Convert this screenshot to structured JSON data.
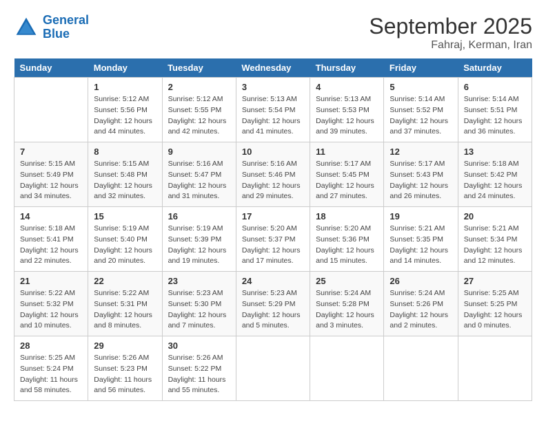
{
  "logo": {
    "line1": "General",
    "line2": "Blue"
  },
  "title": "September 2025",
  "location": "Fahraj, Kerman, Iran",
  "days_of_week": [
    "Sunday",
    "Monday",
    "Tuesday",
    "Wednesday",
    "Thursday",
    "Friday",
    "Saturday"
  ],
  "weeks": [
    [
      {
        "day": "",
        "sunrise": "",
        "sunset": "",
        "daylight": ""
      },
      {
        "day": "1",
        "sunrise": "Sunrise: 5:12 AM",
        "sunset": "Sunset: 5:56 PM",
        "daylight": "Daylight: 12 hours and 44 minutes."
      },
      {
        "day": "2",
        "sunrise": "Sunrise: 5:12 AM",
        "sunset": "Sunset: 5:55 PM",
        "daylight": "Daylight: 12 hours and 42 minutes."
      },
      {
        "day": "3",
        "sunrise": "Sunrise: 5:13 AM",
        "sunset": "Sunset: 5:54 PM",
        "daylight": "Daylight: 12 hours and 41 minutes."
      },
      {
        "day": "4",
        "sunrise": "Sunrise: 5:13 AM",
        "sunset": "Sunset: 5:53 PM",
        "daylight": "Daylight: 12 hours and 39 minutes."
      },
      {
        "day": "5",
        "sunrise": "Sunrise: 5:14 AM",
        "sunset": "Sunset: 5:52 PM",
        "daylight": "Daylight: 12 hours and 37 minutes."
      },
      {
        "day": "6",
        "sunrise": "Sunrise: 5:14 AM",
        "sunset": "Sunset: 5:51 PM",
        "daylight": "Daylight: 12 hours and 36 minutes."
      }
    ],
    [
      {
        "day": "7",
        "sunrise": "Sunrise: 5:15 AM",
        "sunset": "Sunset: 5:49 PM",
        "daylight": "Daylight: 12 hours and 34 minutes."
      },
      {
        "day": "8",
        "sunrise": "Sunrise: 5:15 AM",
        "sunset": "Sunset: 5:48 PM",
        "daylight": "Daylight: 12 hours and 32 minutes."
      },
      {
        "day": "9",
        "sunrise": "Sunrise: 5:16 AM",
        "sunset": "Sunset: 5:47 PM",
        "daylight": "Daylight: 12 hours and 31 minutes."
      },
      {
        "day": "10",
        "sunrise": "Sunrise: 5:16 AM",
        "sunset": "Sunset: 5:46 PM",
        "daylight": "Daylight: 12 hours and 29 minutes."
      },
      {
        "day": "11",
        "sunrise": "Sunrise: 5:17 AM",
        "sunset": "Sunset: 5:45 PM",
        "daylight": "Daylight: 12 hours and 27 minutes."
      },
      {
        "day": "12",
        "sunrise": "Sunrise: 5:17 AM",
        "sunset": "Sunset: 5:43 PM",
        "daylight": "Daylight: 12 hours and 26 minutes."
      },
      {
        "day": "13",
        "sunrise": "Sunrise: 5:18 AM",
        "sunset": "Sunset: 5:42 PM",
        "daylight": "Daylight: 12 hours and 24 minutes."
      }
    ],
    [
      {
        "day": "14",
        "sunrise": "Sunrise: 5:18 AM",
        "sunset": "Sunset: 5:41 PM",
        "daylight": "Daylight: 12 hours and 22 minutes."
      },
      {
        "day": "15",
        "sunrise": "Sunrise: 5:19 AM",
        "sunset": "Sunset: 5:40 PM",
        "daylight": "Daylight: 12 hours and 20 minutes."
      },
      {
        "day": "16",
        "sunrise": "Sunrise: 5:19 AM",
        "sunset": "Sunset: 5:39 PM",
        "daylight": "Daylight: 12 hours and 19 minutes."
      },
      {
        "day": "17",
        "sunrise": "Sunrise: 5:20 AM",
        "sunset": "Sunset: 5:37 PM",
        "daylight": "Daylight: 12 hours and 17 minutes."
      },
      {
        "day": "18",
        "sunrise": "Sunrise: 5:20 AM",
        "sunset": "Sunset: 5:36 PM",
        "daylight": "Daylight: 12 hours and 15 minutes."
      },
      {
        "day": "19",
        "sunrise": "Sunrise: 5:21 AM",
        "sunset": "Sunset: 5:35 PM",
        "daylight": "Daylight: 12 hours and 14 minutes."
      },
      {
        "day": "20",
        "sunrise": "Sunrise: 5:21 AM",
        "sunset": "Sunset: 5:34 PM",
        "daylight": "Daylight: 12 hours and 12 minutes."
      }
    ],
    [
      {
        "day": "21",
        "sunrise": "Sunrise: 5:22 AM",
        "sunset": "Sunset: 5:32 PM",
        "daylight": "Daylight: 12 hours and 10 minutes."
      },
      {
        "day": "22",
        "sunrise": "Sunrise: 5:22 AM",
        "sunset": "Sunset: 5:31 PM",
        "daylight": "Daylight: 12 hours and 8 minutes."
      },
      {
        "day": "23",
        "sunrise": "Sunrise: 5:23 AM",
        "sunset": "Sunset: 5:30 PM",
        "daylight": "Daylight: 12 hours and 7 minutes."
      },
      {
        "day": "24",
        "sunrise": "Sunrise: 5:23 AM",
        "sunset": "Sunset: 5:29 PM",
        "daylight": "Daylight: 12 hours and 5 minutes."
      },
      {
        "day": "25",
        "sunrise": "Sunrise: 5:24 AM",
        "sunset": "Sunset: 5:28 PM",
        "daylight": "Daylight: 12 hours and 3 minutes."
      },
      {
        "day": "26",
        "sunrise": "Sunrise: 5:24 AM",
        "sunset": "Sunset: 5:26 PM",
        "daylight": "Daylight: 12 hours and 2 minutes."
      },
      {
        "day": "27",
        "sunrise": "Sunrise: 5:25 AM",
        "sunset": "Sunset: 5:25 PM",
        "daylight": "Daylight: 12 hours and 0 minutes."
      }
    ],
    [
      {
        "day": "28",
        "sunrise": "Sunrise: 5:25 AM",
        "sunset": "Sunset: 5:24 PM",
        "daylight": "Daylight: 11 hours and 58 minutes."
      },
      {
        "day": "29",
        "sunrise": "Sunrise: 5:26 AM",
        "sunset": "Sunset: 5:23 PM",
        "daylight": "Daylight: 11 hours and 56 minutes."
      },
      {
        "day": "30",
        "sunrise": "Sunrise: 5:26 AM",
        "sunset": "Sunset: 5:22 PM",
        "daylight": "Daylight: 11 hours and 55 minutes."
      },
      {
        "day": "",
        "sunrise": "",
        "sunset": "",
        "daylight": ""
      },
      {
        "day": "",
        "sunrise": "",
        "sunset": "",
        "daylight": ""
      },
      {
        "day": "",
        "sunrise": "",
        "sunset": "",
        "daylight": ""
      },
      {
        "day": "",
        "sunrise": "",
        "sunset": "",
        "daylight": ""
      }
    ]
  ]
}
